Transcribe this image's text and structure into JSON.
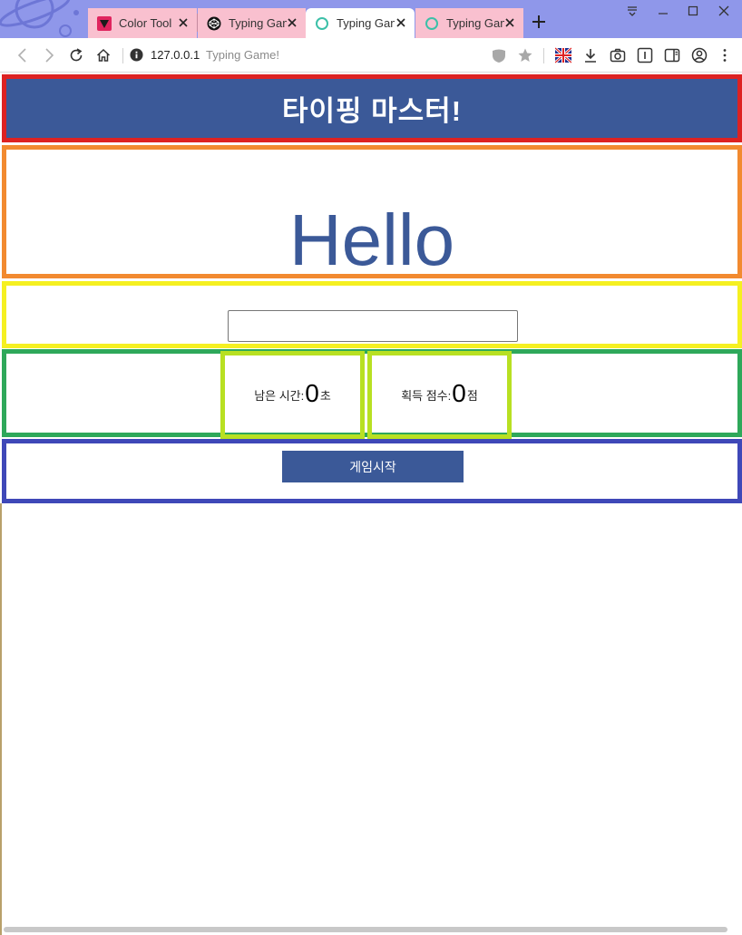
{
  "browser": {
    "tabs": [
      {
        "title": "Color Tool",
        "icon": "color-tool-icon",
        "active": false
      },
      {
        "title": "Typing Game",
        "icon": "codepen-icon",
        "active": false
      },
      {
        "title": "Typing Game",
        "icon": "loading-ring-icon",
        "active": true
      },
      {
        "title": "Typing Game",
        "icon": "loading-ring-icon",
        "active": false
      }
    ],
    "address": {
      "host": "127.0.0.1",
      "page_title": "Typing Game!"
    },
    "colors": {
      "tabbar": "#8f97ea",
      "inactive_tab": "#f9c0cf"
    }
  },
  "page": {
    "title": "타이핑 마스터!",
    "word": "Hello",
    "input": {
      "value": "",
      "placeholder": ""
    },
    "time": {
      "label": "남은 시간:",
      "value": "0",
      "unit": "초"
    },
    "score": {
      "label": "획득 점수:",
      "value": "0",
      "unit": "점"
    },
    "start_button": "게임시작",
    "colors": {
      "primary": "#3b5998",
      "header_border": "#dd2222",
      "word_border": "#f28a30",
      "input_border": "#f5f021",
      "status_border": "#2ea85a",
      "stat_border": "#b8e022",
      "button_border": "#3f48b8"
    }
  }
}
